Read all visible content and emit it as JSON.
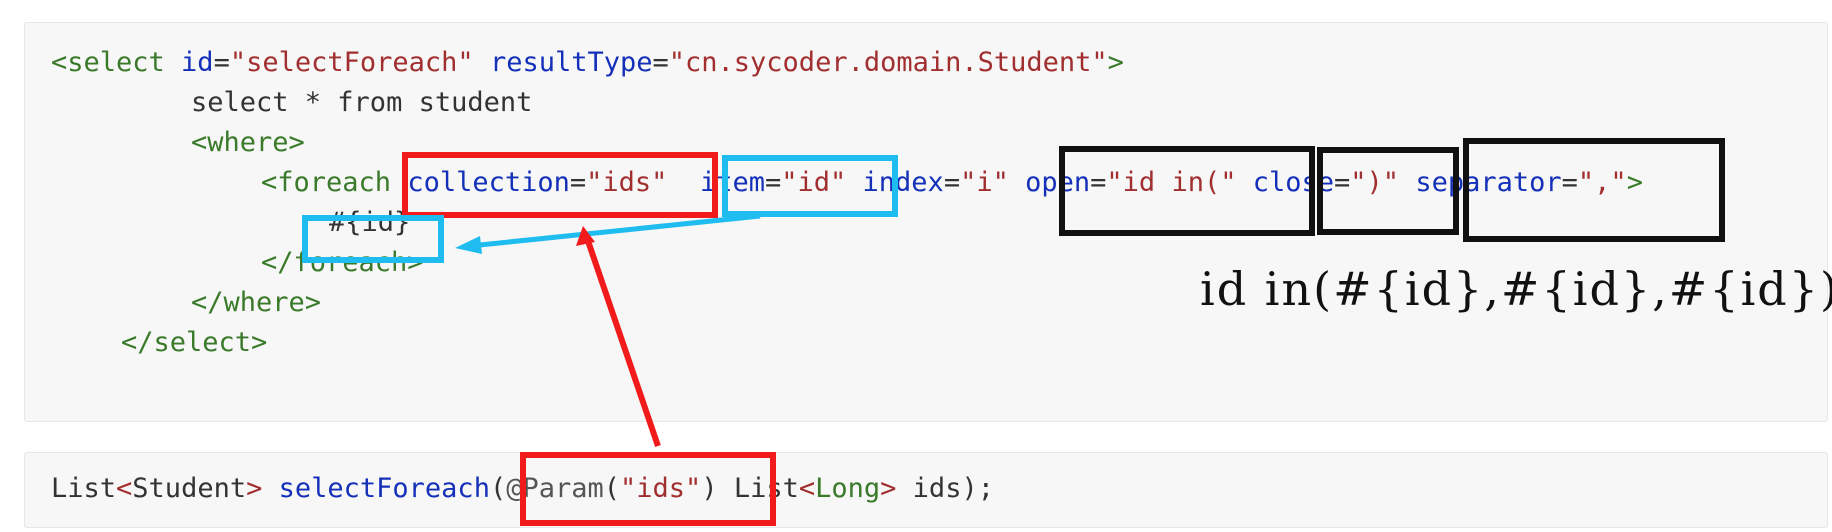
{
  "xml_block": {
    "lines": [
      [
        {
          "t": "<select ",
          "c": "tag"
        },
        {
          "t": "id",
          "c": "attr"
        },
        {
          "t": "=",
          "c": "plain"
        },
        {
          "t": "\"selectForeach\"",
          "c": "str"
        },
        {
          "t": " ",
          "c": "plain"
        },
        {
          "t": "resultType",
          "c": "attr"
        },
        {
          "t": "=",
          "c": "plain"
        },
        {
          "t": "\"cn.sycoder.domain.Student\"",
          "c": "str"
        },
        {
          "t": ">",
          "c": "tag"
        }
      ],
      [
        {
          "t": "select * from student",
          "c": "plain"
        }
      ],
      [
        {
          "t": "<where>",
          "c": "tag"
        }
      ],
      [
        {
          "t": "<foreach ",
          "c": "tag"
        },
        {
          "t": "collection",
          "c": "attr"
        },
        {
          "t": "=",
          "c": "plain"
        },
        {
          "t": "\"ids\"",
          "c": "str"
        },
        {
          "t": "  ",
          "c": "plain"
        },
        {
          "t": "item",
          "c": "attr"
        },
        {
          "t": "=",
          "c": "plain"
        },
        {
          "t": "\"id\"",
          "c": "str"
        },
        {
          "t": " ",
          "c": "plain"
        },
        {
          "t": "index",
          "c": "attr"
        },
        {
          "t": "=",
          "c": "plain"
        },
        {
          "t": "\"i\"",
          "c": "str"
        },
        {
          "t": " ",
          "c": "plain"
        },
        {
          "t": "open",
          "c": "attr"
        },
        {
          "t": "=",
          "c": "plain"
        },
        {
          "t": "\"id in(\"",
          "c": "str"
        },
        {
          "t": " ",
          "c": "plain"
        },
        {
          "t": "close",
          "c": "attr"
        },
        {
          "t": "=",
          "c": "plain"
        },
        {
          "t": "\")\"",
          "c": "str"
        },
        {
          "t": " ",
          "c": "plain"
        },
        {
          "t": "separator",
          "c": "attr"
        },
        {
          "t": "=",
          "c": "plain"
        },
        {
          "t": "\",\"",
          "c": "str"
        },
        {
          "t": ">",
          "c": "tag"
        }
      ],
      [
        {
          "t": "#{id}",
          "c": "plain"
        }
      ],
      [
        {
          "t": "</foreach>",
          "c": "tag"
        }
      ],
      [
        {
          "t": "</where>",
          "c": "tag"
        }
      ],
      [
        {
          "t": "</select>",
          "c": "tag"
        }
      ]
    ]
  },
  "java_block": {
    "lines": [
      [
        {
          "t": "List",
          "c": "plain"
        },
        {
          "t": "<",
          "c": "punc"
        },
        {
          "t": "Student",
          "c": "plain"
        },
        {
          "t": ">",
          "c": "punc"
        },
        {
          "t": " ",
          "c": "plain"
        },
        {
          "t": "selectForeach",
          "c": "kw"
        },
        {
          "t": "(",
          "c": "plain"
        },
        {
          "t": "@Param",
          "c": "ann"
        },
        {
          "t": "(",
          "c": "plain"
        },
        {
          "t": "\"ids\"",
          "c": "str"
        },
        {
          "t": ")",
          "c": "plain"
        },
        {
          "t": " List",
          "c": "plain"
        },
        {
          "t": "<",
          "c": "punc"
        },
        {
          "t": "Long",
          "c": "type"
        },
        {
          "t": ">",
          "c": "punc"
        },
        {
          "t": " ids);",
          "c": "plain"
        }
      ]
    ]
  },
  "result_annotation": "id in(#{id},#{id},#{id})",
  "colors": {
    "highlight_red": "#f21b1b",
    "highlight_blue": "#1ebcef",
    "highlight_black": "#111111"
  }
}
